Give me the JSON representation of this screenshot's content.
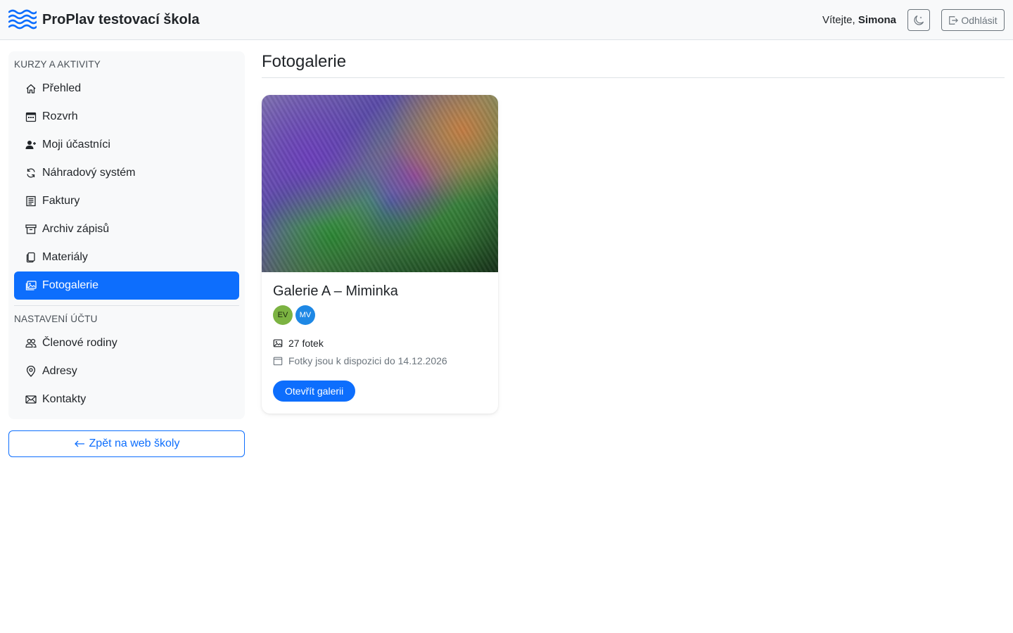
{
  "header": {
    "brand_title": "ProPlav testovací škola",
    "welcome_prefix": "Vítejte,",
    "user_name": "Simona",
    "logout_label": "Odhlásit"
  },
  "sidebar": {
    "section1_title": "KURZY A AKTIVITY",
    "items1": [
      {
        "label": "Přehled",
        "icon": "house-icon"
      },
      {
        "label": "Rozvrh",
        "icon": "calendar-icon"
      },
      {
        "label": "Moji účastníci",
        "icon": "person-add-icon"
      },
      {
        "label": "Náhradový systém",
        "icon": "refresh-icon"
      },
      {
        "label": "Faktury",
        "icon": "invoice-icon"
      },
      {
        "label": "Archiv zápisů",
        "icon": "archive-icon"
      },
      {
        "label": "Materiály",
        "icon": "documents-icon"
      },
      {
        "label": "Fotogalerie",
        "icon": "images-icon",
        "active": true
      }
    ],
    "section2_title": "NASTAVENÍ ÚČTU",
    "items2": [
      {
        "label": "Členové rodiny",
        "icon": "people-icon"
      },
      {
        "label": "Adresy",
        "icon": "map-pin-icon"
      },
      {
        "label": "Kontakty",
        "icon": "envelope-icon"
      }
    ],
    "back_label": "Zpět na web školy"
  },
  "main": {
    "page_title": "Fotogalerie",
    "gallery": {
      "title": "Galerie A – Miminka",
      "avatars": [
        {
          "initials": "EV",
          "bg": "#7cb342",
          "fg": "#1b2a0c"
        },
        {
          "initials": "MV",
          "bg": "#1e88e5",
          "fg": "#ffffff"
        }
      ],
      "photo_count": "27 fotek",
      "availability": "Fotky jsou k dispozici do 14.12.2026",
      "open_label": "Otevřít galerii"
    }
  },
  "colors": {
    "accent": "#0d6efd",
    "sidebar_bg": "#f8f9fa",
    "muted": "#6c757d"
  }
}
